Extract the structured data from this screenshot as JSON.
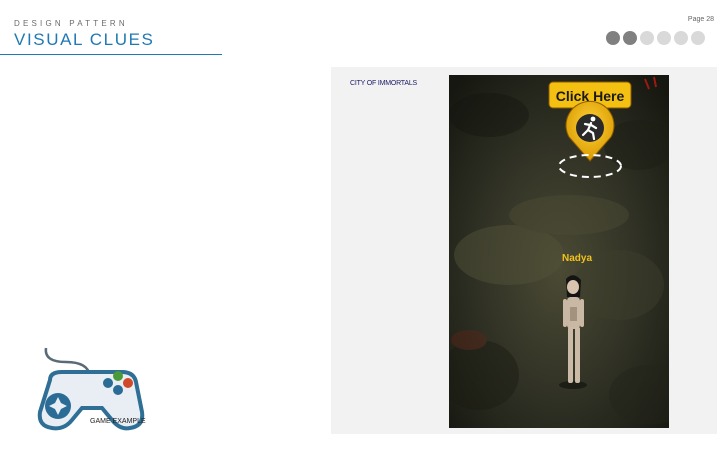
{
  "header": {
    "kicker": "DESIGN PATTERN",
    "title": "VISUAL CLUES",
    "page": "Page 28",
    "accent_color": "#1f79b4"
  },
  "progress_dots": {
    "total": 6,
    "active": 2
  },
  "example": {
    "caption": "CITY OF IMMORTALS",
    "button_label": "Click Here",
    "character_name": "Nadya",
    "button_icon": "running-figure-icon"
  },
  "footer": {
    "icon": "gamepad-icon",
    "label": "GAME EXAMPLE"
  }
}
